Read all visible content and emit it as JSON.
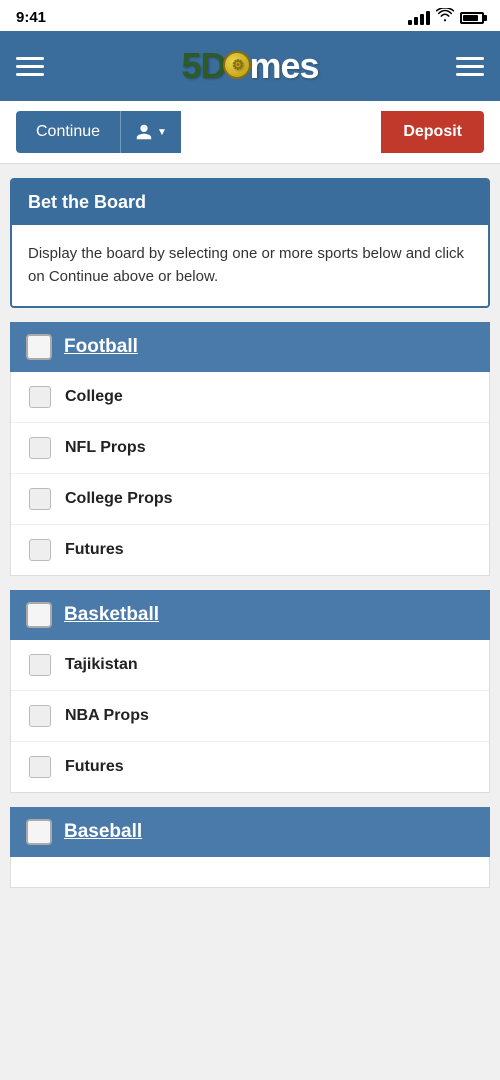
{
  "statusBar": {
    "time": "9:41"
  },
  "header": {
    "logo": "5Dimes",
    "leftMenu": "menu",
    "rightMenu": "menu"
  },
  "toolbar": {
    "continue_label": "Continue",
    "deposit_label": "Deposit"
  },
  "betBoard": {
    "title": "Bet the Board",
    "description": "Display the board by selecting one or more sports below and click on Continue above or below."
  },
  "sports": [
    {
      "name": "Football",
      "checked": false,
      "items": [
        {
          "label": "College",
          "checked": false
        },
        {
          "label": "NFL Props",
          "checked": false
        },
        {
          "label": "College Props",
          "checked": false
        },
        {
          "label": "Futures",
          "checked": false
        }
      ]
    },
    {
      "name": "Basketball",
      "checked": false,
      "items": [
        {
          "label": "Tajikistan",
          "checked": false
        },
        {
          "label": "NBA Props",
          "checked": false
        },
        {
          "label": "Futures",
          "checked": false
        }
      ]
    },
    {
      "name": "Baseball",
      "checked": false,
      "items": []
    }
  ]
}
